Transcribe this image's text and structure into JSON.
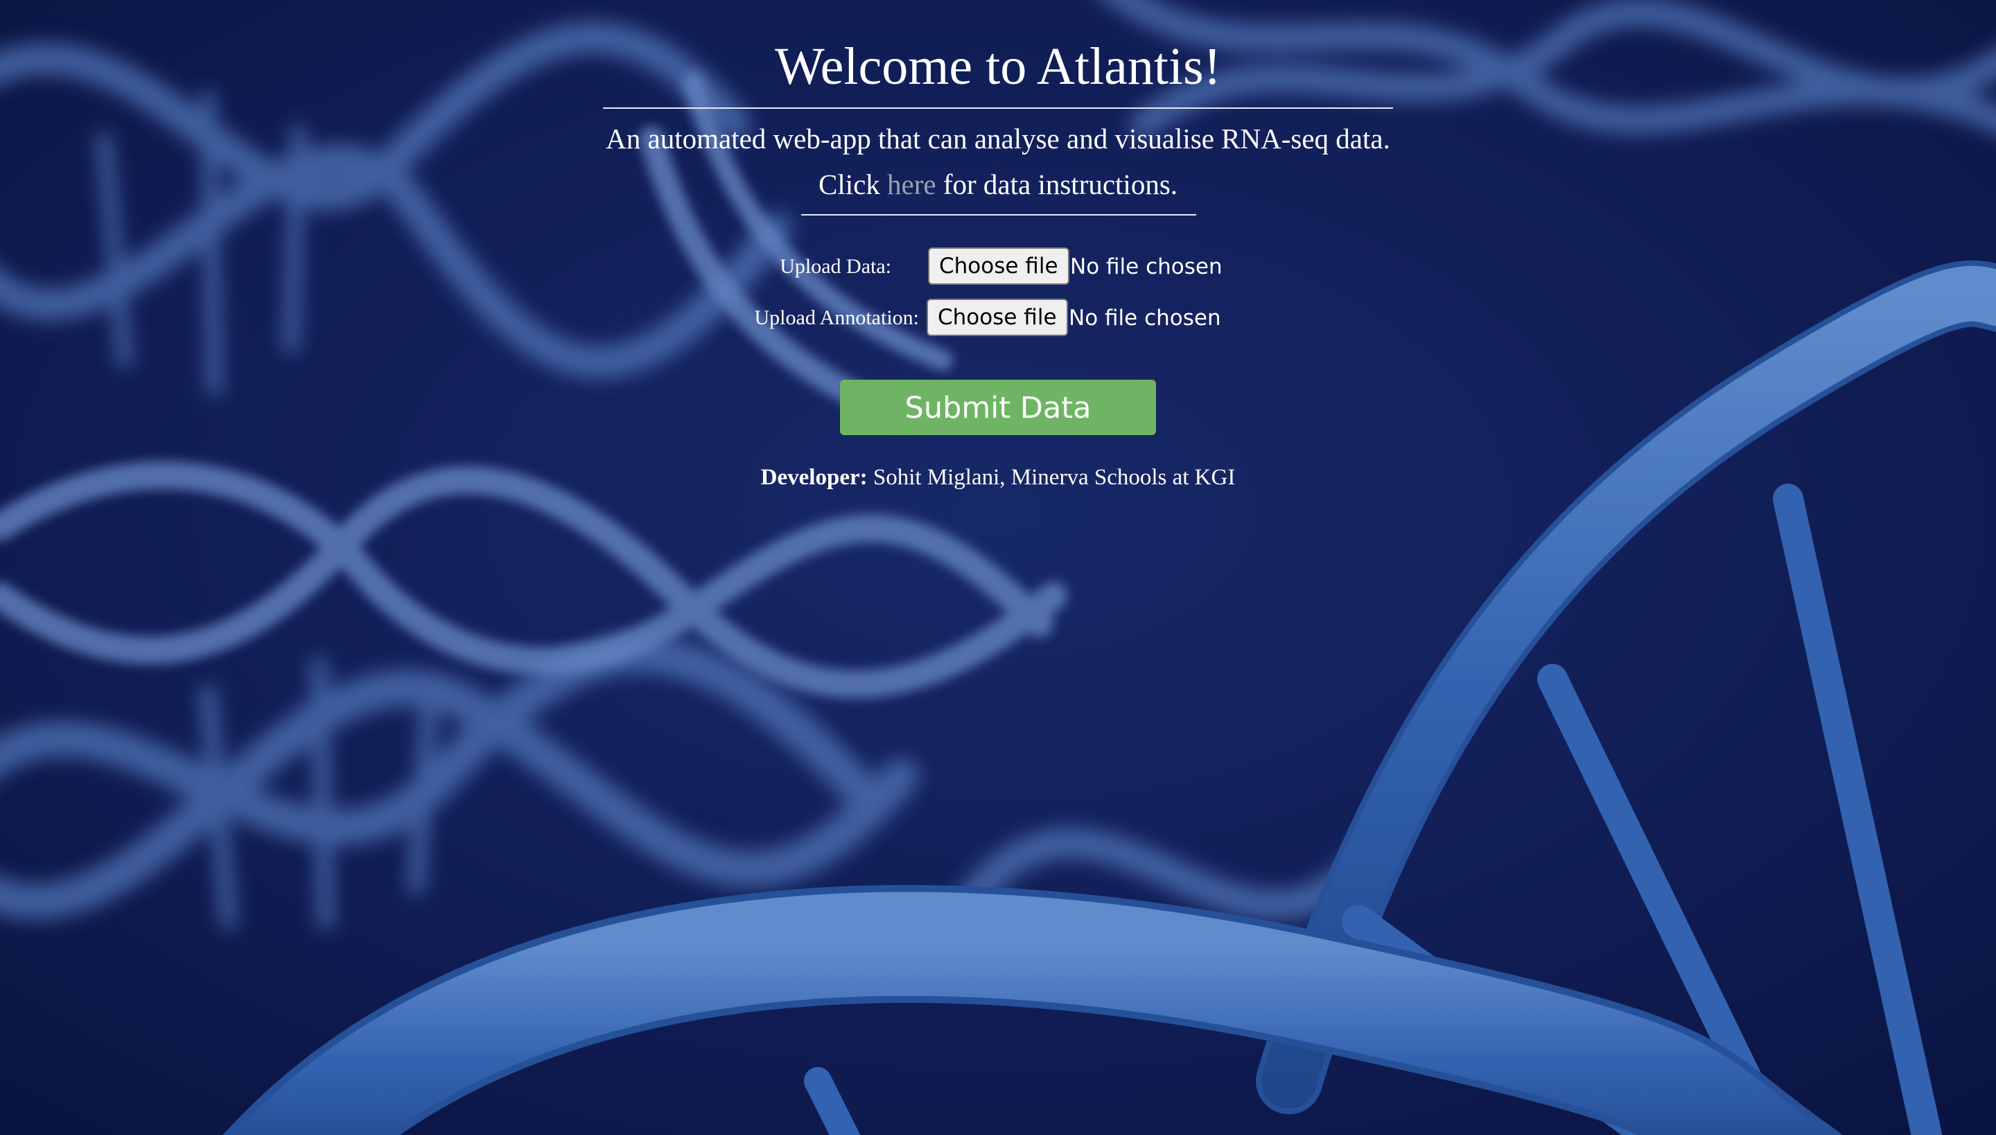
{
  "header": {
    "title": "Welcome to Atlantis!",
    "subtitle": "An automated web-app that can analyse and visualise RNA-seq data.",
    "instructions_prefix": "Click ",
    "instructions_link": "here",
    "instructions_suffix": " for data instructions."
  },
  "uploads": [
    {
      "label": "Upload Data:",
      "button": "Choose file",
      "status": "No file chosen"
    },
    {
      "label": "Upload Annotation:",
      "button": "Choose file",
      "status": "No file chosen"
    }
  ],
  "submit_label": "Submit Data",
  "footer": {
    "developer_label": "Developer:",
    "developer_name": " Sohit Miglani, Minerva Schools at KGI"
  },
  "colors": {
    "background": "#0d1a4a",
    "dna": "#3f72c0",
    "submit": "#6fb465",
    "link": "#9aa1ad"
  },
  "background_image": "blue DNA double helix strands"
}
